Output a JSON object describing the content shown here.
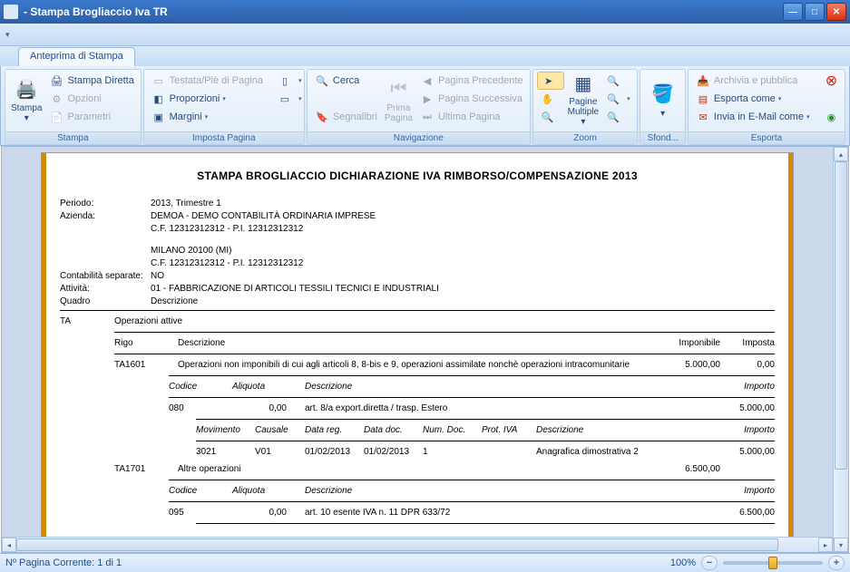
{
  "window": {
    "title": " -  Stampa Brogliaccio Iva TR"
  },
  "tab": {
    "preview": "Anteprima di Stampa"
  },
  "ribbon": {
    "stampa": {
      "title": "Stampa",
      "print": "Stampa",
      "direct": "Stampa Diretta",
      "options": "Opzioni",
      "params": "Parametri"
    },
    "page": {
      "title": "Imposta Pagina",
      "headerfooter": "Testata/Piè di Pagina",
      "scale": "Proporzioni",
      "margins": "Margini"
    },
    "nav": {
      "title": "Navigazione",
      "search": "Cerca",
      "bookmarks": "Segnalibri",
      "firstpage": "Prima Pagina",
      "prevpage": "Pagina Precedente",
      "nextpage": "Pagina Successiva",
      "lastpage": "Ultima Pagina"
    },
    "zoom": {
      "title": "Zoom",
      "multiple": "Pagine Multiple"
    },
    "background": {
      "title": "Sfond..."
    },
    "export": {
      "title": "Esporta",
      "archive": "Archivia e pubblica",
      "exportas": "Esporta come",
      "sendemail": "Invia in E-Mail come"
    }
  },
  "report": {
    "title": "STAMPA  BROGLIACCIO  DICHIARAZIONE  IVA  RIMBORSO/COMPENSAZIONE  2013",
    "periodo_lbl": "Periodo:",
    "periodo": "2013, Trimestre 1",
    "azienda_lbl": "Azienda:",
    "azienda": "DEMOA - DEMO CONTABILITÀ ORDINARIA IMPRESE",
    "cfpi1": "C.F. 12312312312 - P.I. 12312312312",
    "city": "MILANO 20100 (MI)",
    "cfpi2": "C.F. 12312312312 - P.I. 12312312312",
    "separate_lbl": "Contabilità separate:",
    "separate": "NO",
    "attivita_lbl": "Attività:",
    "attivita": "01 - FABBRICAZIONE DI ARTICOLI TESSILI TECNICI E INDUSTRIALI",
    "quadro_lbl": "Quadro",
    "descr_lbl": "Descrizione",
    "ta": "TA",
    "opattive": "Operazioni attive",
    "rigo_h": "Rigo",
    "descr_h": "Descrizione",
    "imponibile_h": "Imponibile",
    "imposta_h": "Imposta",
    "ta1601": {
      "code": "TA1601",
      "descr": "Operazioni non imponibili di cui agli articoli 8, 8-bis e 9, operazioni assimilate nonchè operazioni intracomunitarie",
      "imponibile": "5.000,00",
      "imposta": "0,00"
    },
    "subhdr": {
      "codice": "Codice",
      "aliquota": "Aliquota",
      "descrizione": "Descrizione",
      "importo": "Importo"
    },
    "line080": {
      "codice": "080",
      "aliquota": "0,00",
      "descr": "art. 8/a export.diretta / trasp. Estero",
      "importo": "5.000,00"
    },
    "movhdr": {
      "mov": "Movimento",
      "causale": "Causale",
      "datareg": "Data reg.",
      "datadoc": "Data doc.",
      "numdoc": "Num. Doc.",
      "protiva": "Prot. IVA",
      "descr": "Descrizione",
      "importo": "Importo"
    },
    "mov3021": {
      "mov": "3021",
      "causale": "V01",
      "datareg": "01/02/2013",
      "datadoc": "01/02/2013",
      "numdoc": "1",
      "descr": "Anagrafica dimostrativa 2",
      "importo": "5.000,00"
    },
    "ta1701": {
      "code": "TA1701",
      "descr": "Altre operazioni",
      "importo": "6.500,00"
    },
    "line095": {
      "codice": "095",
      "aliquota": "0,00",
      "descr": "art. 10 esente IVA n. 11 DPR 633/72",
      "importo": "6.500,00"
    }
  },
  "status": {
    "page": "Nº Pagina Corrente: 1 di 1",
    "zoom": "100%"
  }
}
